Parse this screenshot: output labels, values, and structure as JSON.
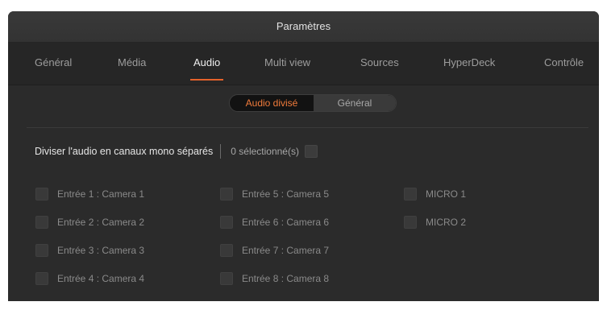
{
  "window": {
    "title": "Paramètres"
  },
  "tabs": [
    {
      "label": "Général"
    },
    {
      "label": "Média"
    },
    {
      "label": "Audio"
    },
    {
      "label": "Multi view"
    },
    {
      "label": "Sources"
    },
    {
      "label": "HyperDeck"
    },
    {
      "label": "Contrôle"
    }
  ],
  "active_tab": "Audio",
  "segmented": {
    "left_label": "Audio divisé",
    "right_label": "Général",
    "selected": "Audio divisé"
  },
  "split": {
    "label": "Diviser l'audio en canaux mono séparés",
    "count_label": "0 sélectionné(s)",
    "select_all_checked": false
  },
  "inputs": [
    {
      "label": "Entrée 1 : Camera 1",
      "checked": false
    },
    {
      "label": "Entrée 2 : Camera 2",
      "checked": false
    },
    {
      "label": "Entrée 3 : Camera 3",
      "checked": false
    },
    {
      "label": "Entrée 4 : Camera 4",
      "checked": false
    },
    {
      "label": "Entrée 5 : Camera 5",
      "checked": false
    },
    {
      "label": "Entrée 6 : Camera 6",
      "checked": false
    },
    {
      "label": "Entrée 7 : Camera 7",
      "checked": false
    },
    {
      "label": "Entrée 8 : Camera 8",
      "checked": false
    },
    {
      "label": "MICRO 1",
      "checked": false
    },
    {
      "label": "MICRO 2",
      "checked": false
    }
  ],
  "colors": {
    "accent": "#e4622b",
    "panel": "#2b2b2b",
    "tabbar": "#262626"
  }
}
